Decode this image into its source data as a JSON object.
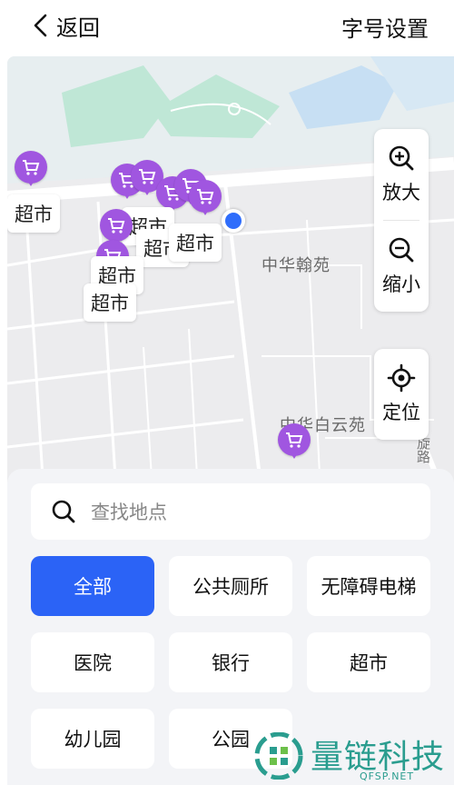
{
  "header": {
    "back_label": "返回",
    "font_setting_label": "字号设置"
  },
  "map": {
    "area_labels": [
      "中华翰苑",
      "中华白云苑"
    ],
    "road_label": "旋路",
    "poi_label": "超市",
    "poi_icon": "shopping-cart-icon",
    "poi_color": "#a056e0",
    "location_color": "#2f6dfb",
    "controls": {
      "zoom_in_label": "放大",
      "zoom_out_label": "缩小",
      "locate_label": "定位"
    }
  },
  "search": {
    "placeholder": "查找地点"
  },
  "categories": [
    {
      "label": "全部",
      "active": true
    },
    {
      "label": "公共厕所",
      "active": false
    },
    {
      "label": "无障碍电梯",
      "active": false
    },
    {
      "label": "医院",
      "active": false
    },
    {
      "label": "银行",
      "active": false
    },
    {
      "label": "超市",
      "active": false
    },
    {
      "label": "幼儿园",
      "active": false
    },
    {
      "label": "公园",
      "active": false
    }
  ],
  "accent_color": "#2b63f6",
  "watermark": {
    "title": "量链科技",
    "subtitle": "QFSP.NET"
  }
}
